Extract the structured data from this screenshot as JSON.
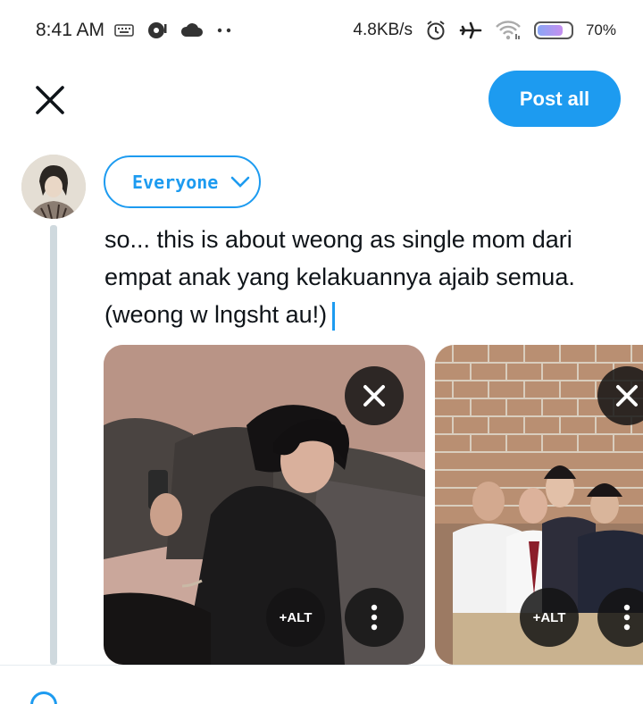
{
  "status_bar": {
    "time": "8:41 AM",
    "network_speed": "4.8KB/s",
    "battery_percent": "70%",
    "battery_level": 0.7
  },
  "header": {
    "close_icon": "close-icon",
    "post_all_label": "Post all"
  },
  "composer": {
    "audience_label": "Everyone",
    "tweet_text": "so... this is about weong as single mom dari empat anak yang kelakuannya ajaib semua. (weong w lngsht au!)",
    "media": [
      {
        "alt_label": "+ALT"
      },
      {
        "alt_label": "+ALT"
      }
    ]
  },
  "colors": {
    "accent": "#1d9bf0",
    "thread_line": "#cfd9de"
  }
}
